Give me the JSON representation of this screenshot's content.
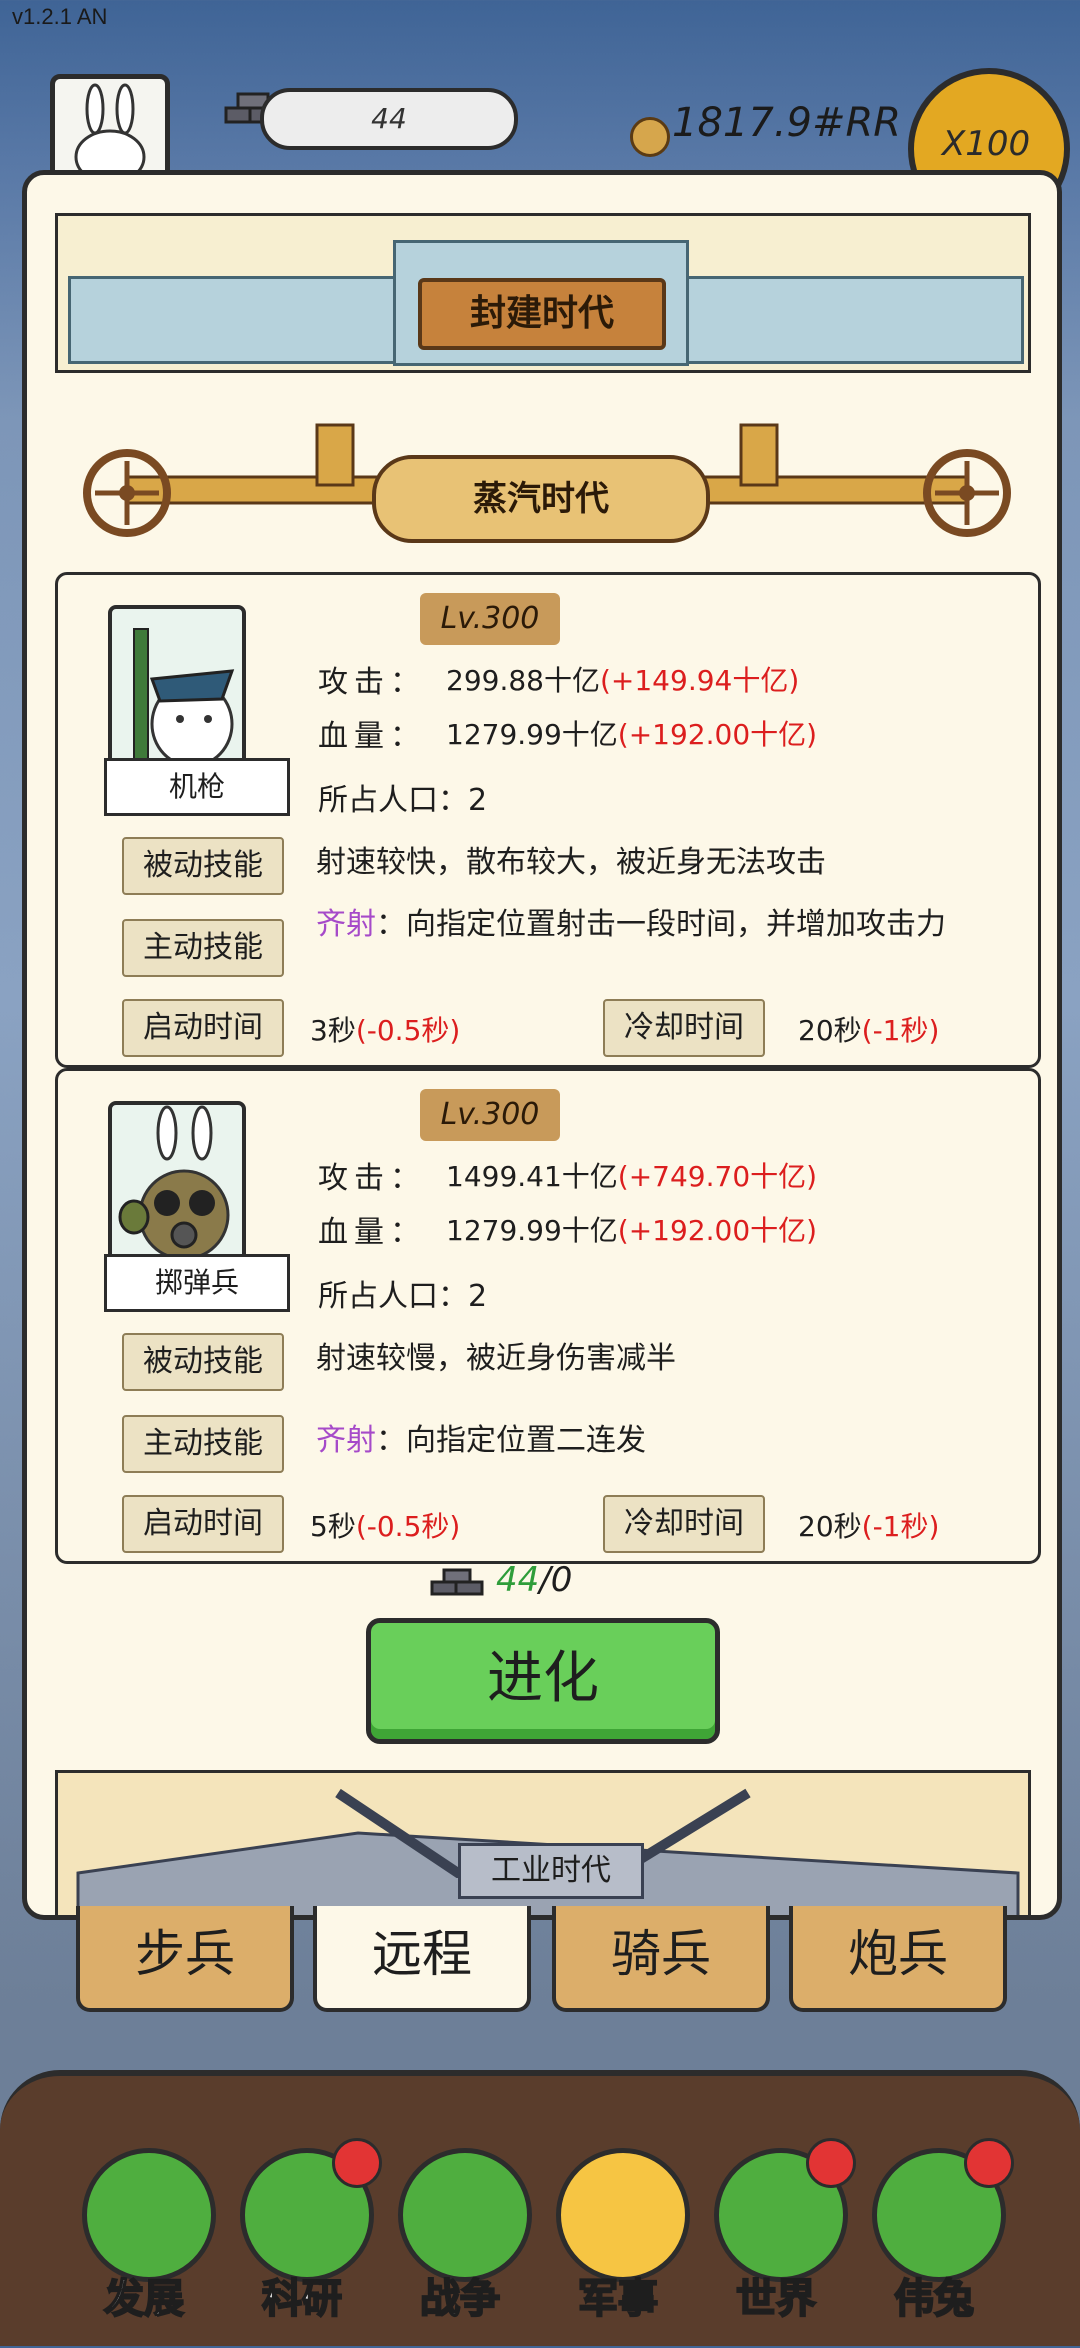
{
  "version": "v1.2.1 AN",
  "header": {
    "iron_amount": "44",
    "coins": "1817.9#RR",
    "multiplier": "X100"
  },
  "era_current": "封建时代",
  "era_next": "蒸汽时代",
  "era_after": "工业时代",
  "labels": {
    "attack": "攻击：",
    "health": "血量：",
    "population": "所占人口：2",
    "passive": "被动技能",
    "active": "主动技能",
    "startup": "启动时间",
    "cooldown": "冷却时间"
  },
  "units": [
    {
      "name": "机枪",
      "level": "Lv.300",
      "attack": "299.88十亿",
      "attack_bonus": "(+149.94十亿)",
      "health": "1279.99十亿",
      "health_bonus": "(+192.00十亿)",
      "passive": "射速较快，散布较大，被近身无法攻击",
      "active_name": "齐射",
      "active_desc": "：向指定位置射击一段时间，并增加攻击力",
      "startup": "3秒",
      "startup_bonus": "(-0.5秒)",
      "cooldown": "20秒",
      "cooldown_bonus": "(-1秒)"
    },
    {
      "name": "掷弹兵",
      "level": "Lv.300",
      "attack": "1499.41十亿",
      "attack_bonus": "(+749.70十亿)",
      "health": "1279.99十亿",
      "health_bonus": "(+192.00十亿)",
      "passive": "射速较慢，被近身伤害减半",
      "active_name": "齐射",
      "active_desc": "：向指定位置二连发",
      "startup": "5秒",
      "startup_bonus": "(-0.5秒)",
      "cooldown": "20秒",
      "cooldown_bonus": "(-1秒)"
    }
  ],
  "evolve": {
    "have": "44",
    "need": "/0",
    "button": "进化"
  },
  "tabs": [
    "步兵",
    "远程",
    "骑兵",
    "炮兵"
  ],
  "active_tab": "远程",
  "nav": [
    {
      "label": "发展",
      "badge": false
    },
    {
      "label": "科研",
      "badge": true
    },
    {
      "label": "战争",
      "badge": false
    },
    {
      "label": "军事",
      "badge": false
    },
    {
      "label": "世界",
      "badge": true
    },
    {
      "label": "伟兔",
      "badge": true
    }
  ]
}
